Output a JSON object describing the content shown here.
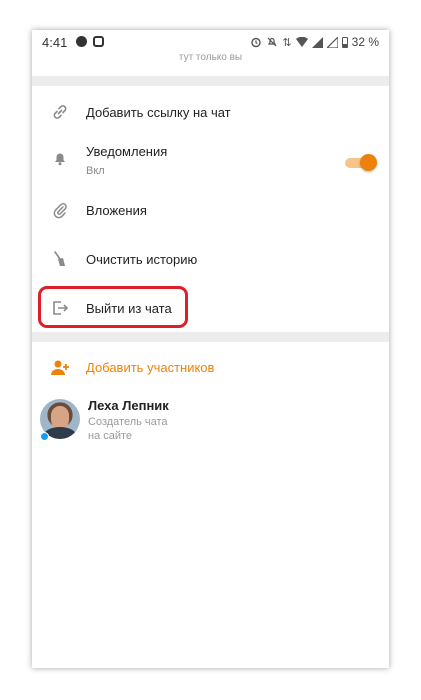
{
  "status_bar": {
    "time": "4:41",
    "battery": "32 %",
    "icons": [
      "record-icon",
      "camera-icon",
      "alarm-icon",
      "mute-icon",
      "wifi-icon",
      "signal-icon",
      "signal-icon",
      "battery-icon"
    ]
  },
  "top_subtitle": "тут только вы",
  "menu": {
    "add_link": "Добавить ссылку на чат",
    "notifications": "Уведомления",
    "notifications_state": "Вкл",
    "attachments": "Вложения",
    "clear_history": "Очистить историю",
    "leave_chat": "Выйти из чата"
  },
  "colors": {
    "accent": "#ee8208",
    "highlight": "#e01e2a",
    "online": "#1a9bf0"
  },
  "participants": {
    "add_label": "Добавить участников",
    "members": [
      {
        "name": "Леха Лепник",
        "role": "Создатель чата",
        "role_2": "на сайте"
      }
    ]
  },
  "toggle_on": true
}
